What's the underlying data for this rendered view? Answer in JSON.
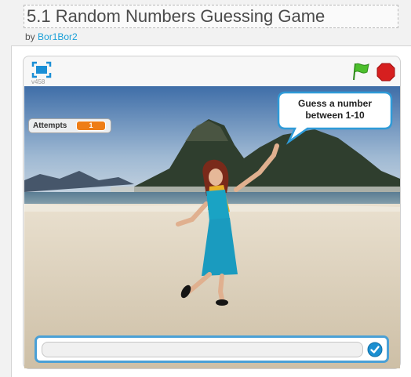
{
  "project": {
    "title": "5.1 Random Numbers Guessing Game",
    "by_prefix": "by",
    "author": "Bor1Bor2"
  },
  "player": {
    "version": "v458",
    "colors": {
      "flag": "#4cbf2c",
      "stop": "#d61f1f",
      "accent": "#4aa0d6"
    }
  },
  "stage": {
    "monitor": {
      "label": "Attempts",
      "value": "1"
    },
    "speech": {
      "line1": "Guess a number",
      "line2": "between 1-10"
    },
    "ask": {
      "value": ""
    }
  },
  "icons": [
    "fullscreen-icon",
    "green-flag-icon",
    "stop-icon",
    "checkmark-icon"
  ]
}
